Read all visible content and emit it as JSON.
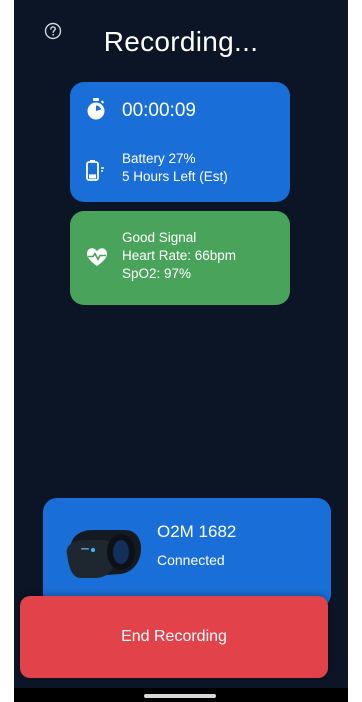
{
  "header": {
    "title": "Recording...",
    "help_icon": "question-circle-icon"
  },
  "status_card": {
    "timer": "00:00:09",
    "timer_icon": "stopwatch-icon",
    "battery_line1": "Battery 27%",
    "battery_line2": "5 Hours Left (Est)",
    "battery_icon": "battery-icon",
    "battery_level": 0.27
  },
  "signal_card": {
    "line1": "Good Signal",
    "line2": "Heart Rate: 66bpm",
    "line3": "SpO2: 97%",
    "icon": "heart-pulse-icon"
  },
  "device": {
    "name": "O2M 1682",
    "status": "Connected",
    "image": "ring-oximeter-device"
  },
  "actions": {
    "end_recording": "End Recording"
  },
  "colors": {
    "background": "#0b1526",
    "status_card": "#1a6ed8",
    "signal_card": "#4aa35a",
    "end_button": "#e2434a"
  }
}
